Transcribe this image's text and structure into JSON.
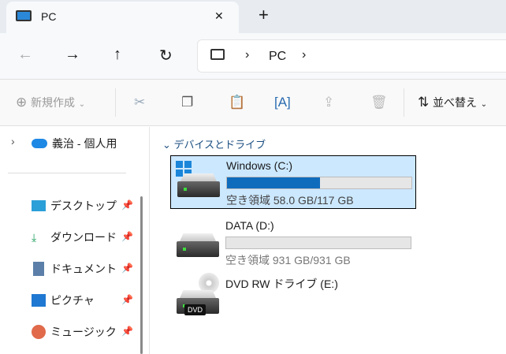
{
  "tab": {
    "title": "PC",
    "close": "✕",
    "new_tab": "+"
  },
  "nav": {
    "back": "←",
    "forward": "→",
    "up": "↑",
    "refresh": "↻",
    "breadcrumb": [
      "PC"
    ]
  },
  "toolbar": {
    "new_label": "新規作成",
    "sort_label": "並べ替え"
  },
  "sidebar": {
    "onedrive": "義治 - 個人用",
    "items": [
      {
        "label": "デスクトップ"
      },
      {
        "label": "ダウンロード"
      },
      {
        "label": "ドキュメント"
      },
      {
        "label": "ピクチャ"
      },
      {
        "label": "ミュージック"
      }
    ]
  },
  "main": {
    "group": "デバイスとドライブ",
    "drives": [
      {
        "name": "Windows (C:)",
        "free": "空き領域 58.0 GB/117 GB",
        "used_fraction": 0.504,
        "selected": true
      },
      {
        "name": "DATA (D:)",
        "free": "空き領域 931 GB/931 GB",
        "used_fraction": 0
      },
      {
        "name": "DVD RW ドライブ (E:)",
        "badge": "DVD"
      }
    ]
  },
  "colors": {
    "accent": "#0f6cbd",
    "selection": "#cce8ff"
  }
}
